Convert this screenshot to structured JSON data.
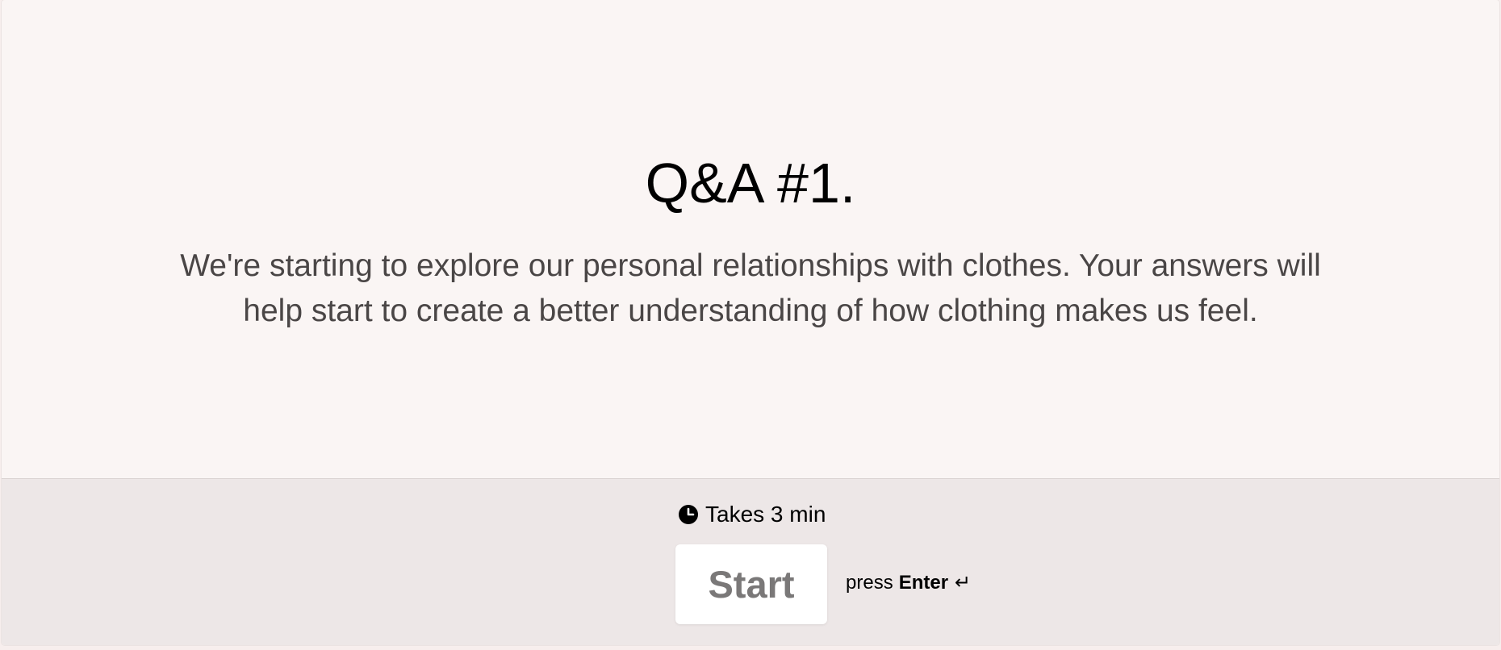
{
  "welcome": {
    "title": "Q&A #1.",
    "description": "We're starting to explore our personal relationships with clothes. Your answers will help start to create a better understanding of how clothing makes us feel."
  },
  "footer": {
    "duration_icon": "clock-icon",
    "duration_text": "Takes 3 min",
    "start_label": "Start",
    "hint_prefix": "press",
    "hint_key": "Enter",
    "hint_icon": "↵"
  },
  "colors": {
    "background": "#faf5f4",
    "footer_background": "#ede7e7",
    "title": "#000000",
    "description": "#4a4646",
    "button_background": "#ffffff",
    "button_text": "#7a7878"
  }
}
